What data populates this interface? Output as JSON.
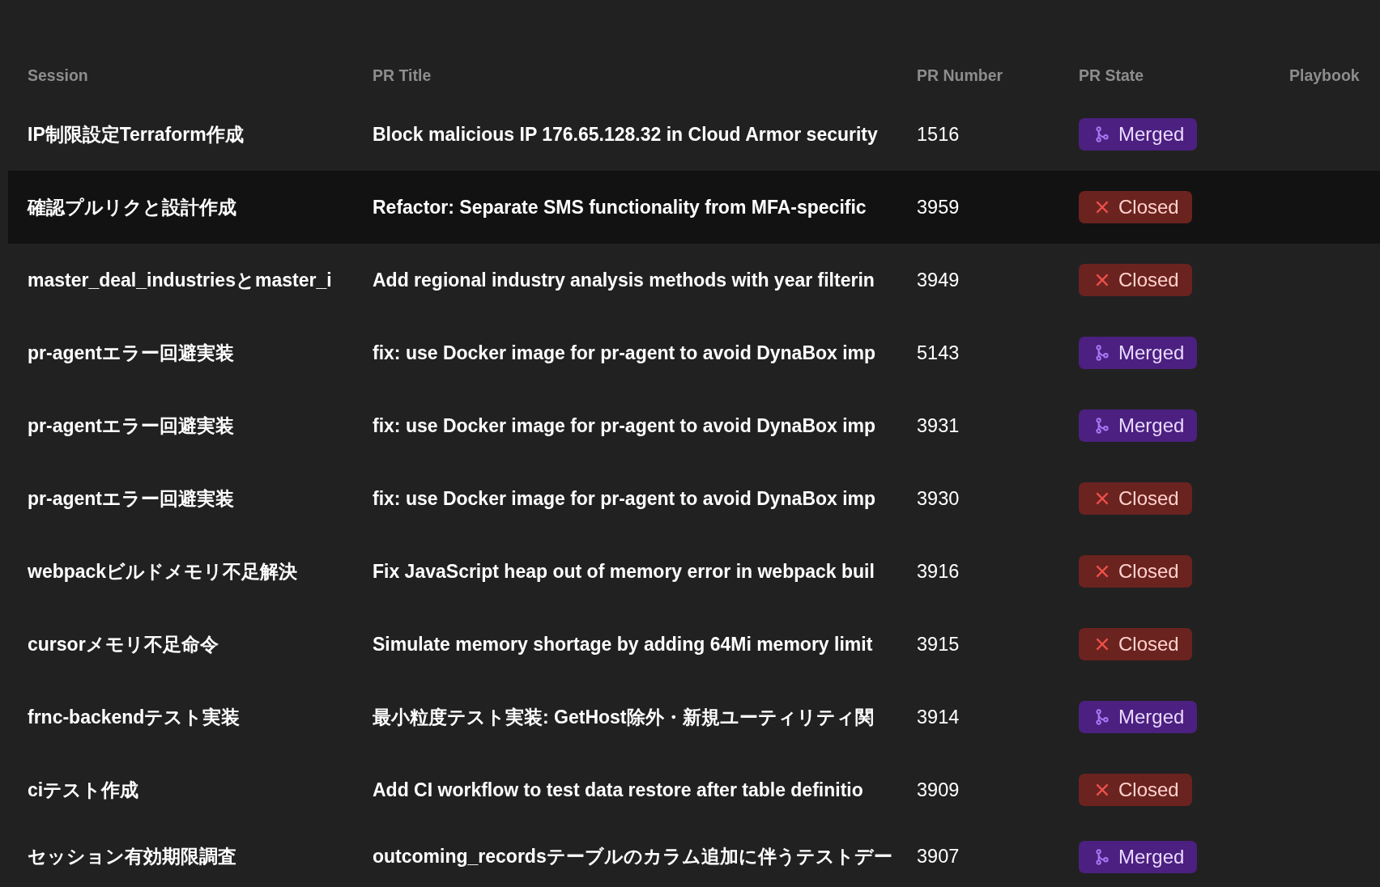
{
  "table": {
    "columns": [
      "Session",
      "PR Title",
      "PR Number",
      "PR State",
      "Playbook"
    ],
    "rows": [
      {
        "session": "IP制限設定Terraform作成",
        "title": "Block malicious IP 176.65.128.32 in Cloud Armor security",
        "number": "1516",
        "state": {
          "kind": "merged",
          "label": "Merged"
        },
        "selected": false
      },
      {
        "session": "確認プルリクと設計作成",
        "title": "Refactor: Separate SMS functionality from MFA-specific",
        "number": "3959",
        "state": {
          "kind": "closed",
          "label": "Closed"
        },
        "selected": true
      },
      {
        "session": "master_deal_industriesとmaster_i",
        "title": "Add regional industry analysis methods with year filterin",
        "number": "3949",
        "state": {
          "kind": "closed",
          "label": "Closed"
        },
        "selected": false
      },
      {
        "session": "pr-agentエラー回避実装",
        "title": "fix: use Docker image for pr-agent to avoid DynaBox imp",
        "number": "5143",
        "state": {
          "kind": "merged",
          "label": "Merged"
        },
        "selected": false
      },
      {
        "session": "pr-agentエラー回避実装",
        "title": "fix: use Docker image for pr-agent to avoid DynaBox imp",
        "number": "3931",
        "state": {
          "kind": "merged",
          "label": "Merged"
        },
        "selected": false
      },
      {
        "session": "pr-agentエラー回避実装",
        "title": "fix: use Docker image for pr-agent to avoid DynaBox imp",
        "number": "3930",
        "state": {
          "kind": "closed",
          "label": "Closed"
        },
        "selected": false
      },
      {
        "session": "webpackビルドメモリ不足解決",
        "title": "Fix JavaScript heap out of memory error in webpack buil",
        "number": "3916",
        "state": {
          "kind": "closed",
          "label": "Closed"
        },
        "selected": false
      },
      {
        "session": "cursorメモリ不足命令",
        "title": "Simulate memory shortage by adding 64Mi memory limit",
        "number": "3915",
        "state": {
          "kind": "closed",
          "label": "Closed"
        },
        "selected": false
      },
      {
        "session": "frnc-backendテスト実装",
        "title": "最小粒度テスト実装: GetHost除外・新規ユーティリティ関",
        "number": "3914",
        "state": {
          "kind": "merged",
          "label": "Merged"
        },
        "selected": false
      },
      {
        "session": "ciテスト作成",
        "title": "Add CI workflow to test data restore after table definitio",
        "number": "3909",
        "state": {
          "kind": "closed",
          "label": "Closed"
        },
        "selected": false
      },
      {
        "session": "セッション有効期限調査",
        "title": "outcoming_recordsテーブルのカラム追加に伴うテストデー",
        "number": "3907",
        "state": {
          "kind": "merged",
          "label": "Merged"
        },
        "selected": false
      }
    ]
  }
}
